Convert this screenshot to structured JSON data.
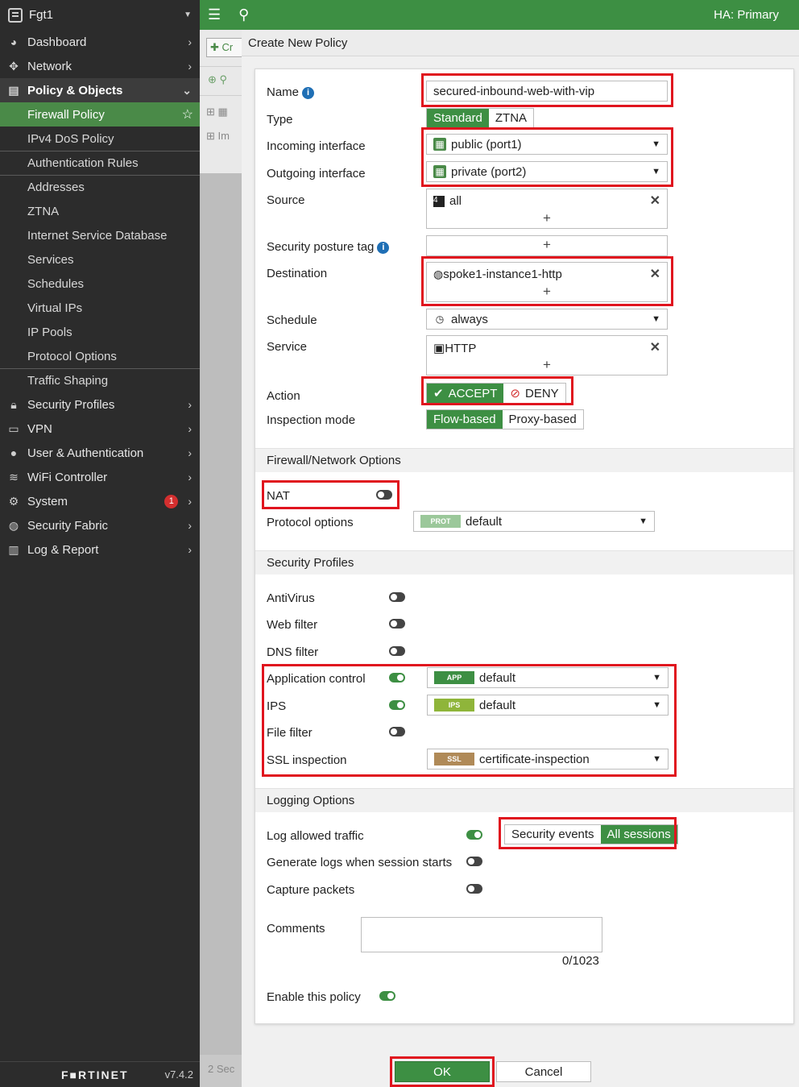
{
  "sidebar": {
    "device_name": "Fgt1",
    "items": [
      {
        "label": "Dashboard",
        "icon": "dashboard-icon"
      },
      {
        "label": "Network",
        "icon": "network-icon"
      },
      {
        "label": "Policy & Objects",
        "icon": "policy-icon"
      }
    ],
    "subitems": [
      "Firewall Policy",
      "IPv4 DoS Policy",
      "Authentication Rules",
      "Addresses",
      "ZTNA",
      "Internet Service Database",
      "Services",
      "Schedules",
      "Virtual IPs",
      "IP Pools",
      "Protocol Options",
      "Traffic Shaping"
    ],
    "lower_items": [
      {
        "label": "Security Profiles",
        "icon": "lock-icon"
      },
      {
        "label": "VPN",
        "icon": "laptop-icon"
      },
      {
        "label": "User & Authentication",
        "icon": "user-icon"
      },
      {
        "label": "WiFi Controller",
        "icon": "wifi-icon"
      },
      {
        "label": "System",
        "icon": "gear-icon",
        "badge": "1"
      },
      {
        "label": "Security Fabric",
        "icon": "fabric-icon"
      },
      {
        "label": "Log & Report",
        "icon": "chart-icon"
      }
    ],
    "footer_logo": "F■RTINET",
    "version": "v7.4.2"
  },
  "topbar": {
    "ha_status": "HA: Primary"
  },
  "background": {
    "create_partial": "Cr",
    "import_partial": "Im",
    "footer_partial": "Sec",
    "footer_count": "2"
  },
  "panel": {
    "title": "Create New Policy",
    "name_label": "Name",
    "name_value": "secured-inbound-web-with-vip",
    "type_label": "Type",
    "type_options": [
      "Standard",
      "ZTNA"
    ],
    "incoming_label": "Incoming interface",
    "incoming_value": "public (port1)",
    "outgoing_label": "Outgoing interface",
    "outgoing_value": "private (port2)",
    "source_label": "Source",
    "source_value": "all",
    "posture_label": "Security posture tag",
    "destination_label": "Destination",
    "destination_value": "spoke1-instance1-http",
    "schedule_label": "Schedule",
    "schedule_value": "always",
    "service_label": "Service",
    "service_value": "HTTP",
    "action_label": "Action",
    "action_accept": "ACCEPT",
    "action_deny": "DENY",
    "inspection_label": "Inspection mode",
    "inspection_options": [
      "Flow-based",
      "Proxy-based"
    ],
    "section_fw": "Firewall/Network Options",
    "nat_label": "NAT",
    "protocol_label": "Protocol options",
    "protocol_tag": "PROT",
    "protocol_value": "default",
    "section_sec": "Security Profiles",
    "antivirus_label": "AntiVirus",
    "webfilter_label": "Web filter",
    "dnsfilter_label": "DNS filter",
    "appctrl_label": "Application control",
    "appctrl_tag": "APP",
    "appctrl_value": "default",
    "ips_label": "IPS",
    "ips_tag": "IPS",
    "ips_value": "default",
    "filefilter_label": "File filter",
    "ssl_label": "SSL inspection",
    "ssl_tag": "SSL",
    "ssl_value": "certificate-inspection",
    "section_log": "Logging Options",
    "log_allowed_label": "Log allowed traffic",
    "log_options": [
      "Security events",
      "All sessions"
    ],
    "gen_logs_label": "Generate logs when session starts",
    "capture_label": "Capture packets",
    "comments_label": "Comments",
    "comments_counter": "0/1023",
    "enable_label": "Enable this policy",
    "ok_label": "OK",
    "cancel_label": "Cancel"
  },
  "colors": {
    "accent": "#3d8f43",
    "highlight": "#e0141e",
    "sidebar": "#2c2c2c"
  }
}
